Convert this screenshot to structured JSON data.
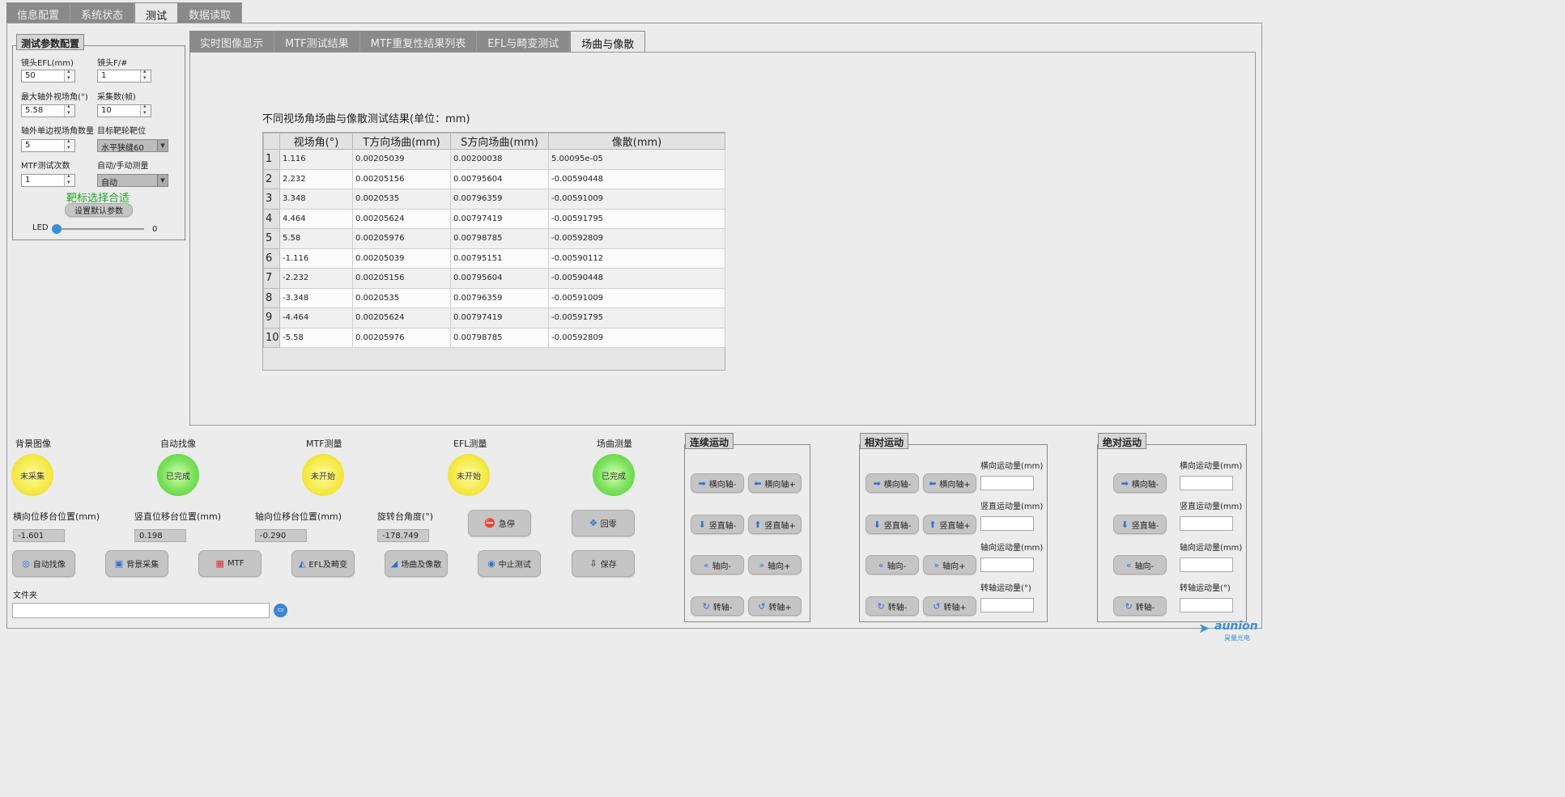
{
  "top_tabs": [
    "信息配置",
    "系统状态",
    "测试",
    "数据读取"
  ],
  "params": {
    "title": "测试参数配置",
    "efl_label": "镜头EFL(mm)",
    "efl_value": "50",
    "fnum_label": "镜头F/#",
    "fnum_value": "1",
    "max_angle_label": "最大轴外视场角(°)",
    "max_angle_value": "5.58",
    "frames_label": "采集数(帧)",
    "frames_value": "10",
    "offaxis_count_label": "轴外单边视场角数量",
    "offaxis_count_value": "5",
    "target_label": "目标靶轮靶位",
    "target_value": "水平狭缝60",
    "mtf_times_label": "MTF测试次数",
    "mtf_times_value": "1",
    "mode_label": "自动/手动测量",
    "mode_value": "自动",
    "target_ok": "靶标选择合适",
    "default_button": "设置默认参数",
    "led_label": "LED",
    "led_value": "0"
  },
  "sub_tabs": [
    "实时图像显示",
    "MTF测试结果",
    "MTF重复性结果列表",
    "EFL与畸变测试",
    "场曲与像散"
  ],
  "results": {
    "caption": "不同视场角场曲与像散测试结果(单位：mm)",
    "headers": [
      "视场角(°)",
      "T方向场曲(mm)",
      "S方向场曲(mm)",
      "像散(mm)"
    ],
    "rows": [
      [
        "1",
        "1.116",
        "0.00205039",
        "0.00200038",
        "5.00095e-05"
      ],
      [
        "2",
        "2.232",
        "0.00205156",
        "0.00795604",
        "-0.00590448"
      ],
      [
        "3",
        "3.348",
        "0.0020535",
        "0.00796359",
        "-0.00591009"
      ],
      [
        "4",
        "4.464",
        "0.00205624",
        "0.00797419",
        "-0.00591795"
      ],
      [
        "5",
        "5.58",
        "0.00205976",
        "0.00798785",
        "-0.00592809"
      ],
      [
        "6",
        "-1.116",
        "0.00205039",
        "0.00795151",
        "-0.00590112"
      ],
      [
        "7",
        "-2.232",
        "0.00205156",
        "0.00795604",
        "-0.00590448"
      ],
      [
        "8",
        "-3.348",
        "0.0020535",
        "0.00796359",
        "-0.00591009"
      ],
      [
        "9",
        "-4.464",
        "0.00205624",
        "0.00797419",
        "-0.00591795"
      ],
      [
        "10",
        "-5.58",
        "0.00205976",
        "0.00798785",
        "-0.00592809"
      ]
    ]
  },
  "status": [
    {
      "label": "背景图像",
      "state": "未采集",
      "color": "yellow"
    },
    {
      "label": "自动找像",
      "state": "已完成",
      "color": "green"
    },
    {
      "label": "MTF测量",
      "state": "未开始",
      "color": "yellow"
    },
    {
      "label": "EFL测量",
      "state": "未开始",
      "color": "yellow"
    },
    {
      "label": "场曲测量",
      "state": "已完成",
      "color": "green"
    }
  ],
  "positions": {
    "h_label": "横向位移台位置(mm)",
    "h_value": "-1.601",
    "v_label": "竖直位移台位置(mm)",
    "v_value": "0.198",
    "a_label": "轴向位移台位置(mm)",
    "a_value": "-0.290",
    "r_label": "旋转台角度(°)",
    "r_value": "-178.749"
  },
  "actions": {
    "estop": "急停",
    "home": "回零",
    "autofocus": "自动找像",
    "background": "背景采集",
    "mtf": "MTF",
    "efl": "EFL及畸变",
    "field": "场曲及像散",
    "stop": "中止测试",
    "save": "保存"
  },
  "folder": {
    "label": "文件夹",
    "value": ""
  },
  "motion": {
    "continuous_title": "连续运动",
    "relative_title": "相对运动",
    "absolute_title": "绝对运动",
    "h_minus": "横向轴-",
    "h_plus": "横向轴+",
    "v_minus": "竖直轴-",
    "v_plus": "竖直轴+",
    "a_minus": "轴向-",
    "a_plus": "轴向+",
    "r_minus": "转轴-",
    "r_plus": "转轴+",
    "h_amount": "横向运动量(mm)",
    "v_amount": "竖直运动量(mm)",
    "a_amount": "轴向运动量(mm)",
    "r_amount": "转轴运动量(°)"
  },
  "logo": {
    "name": "aunion",
    "sub": "昊量光电"
  }
}
